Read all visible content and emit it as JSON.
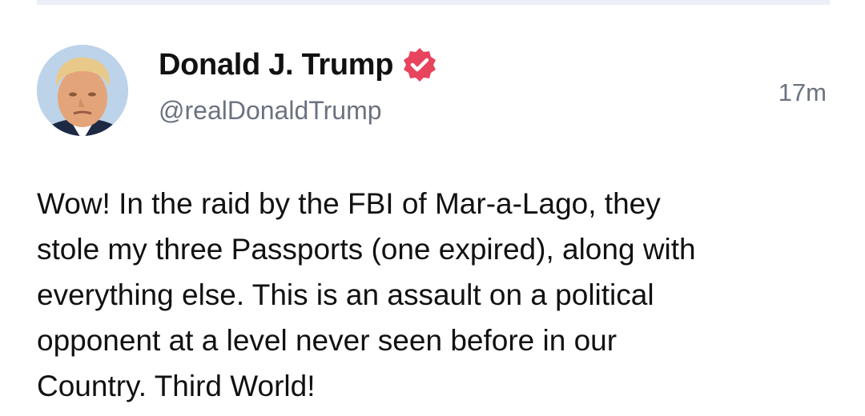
{
  "post": {
    "author": {
      "display_name": "Donald J. Trump",
      "handle": "@realDonaldTrump",
      "verified_icon": "verified-badge-icon",
      "avatar": "profile-avatar"
    },
    "timestamp": "17m",
    "body_lines": [
      "Wow! In the raid by the FBI of Mar-a-Lago, they",
      "stole my three Passports (one expired), along with",
      "everything else. This is an assault on a political",
      "opponent at a level never seen before in our",
      "Country. Third World!"
    ]
  },
  "colors": {
    "verified_badge": "#e8445e",
    "handle_text": "#6b7280",
    "divider": "#eceef8"
  }
}
